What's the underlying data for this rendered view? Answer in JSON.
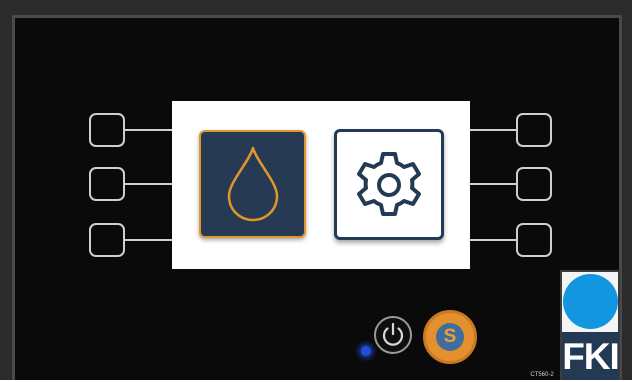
{
  "device": {
    "brand": "FKI",
    "model": "CT560-2",
    "brand_dot_color": "#1396e0",
    "panel_color": "#0a0a0a"
  },
  "screen": {
    "tiles": [
      {
        "icon": "oil-drop-icon",
        "selected": true,
        "border_color": "#e0962b",
        "background": "#273a54"
      },
      {
        "icon": "gear-icon",
        "selected": false,
        "border_color": "#243953",
        "background": "#ffffff"
      }
    ]
  },
  "soft_keys": {
    "left": [
      "left-soft-key-1",
      "left-soft-key-2",
      "left-soft-key-3"
    ],
    "right": [
      "right-soft-key-1",
      "right-soft-key-2",
      "right-soft-key-3"
    ]
  },
  "buttons": {
    "power_icon": "power-icon",
    "start_label": "S",
    "start_color": "#e5902e"
  },
  "indicator": {
    "led_color": "#1e4fd6",
    "state": "on"
  }
}
